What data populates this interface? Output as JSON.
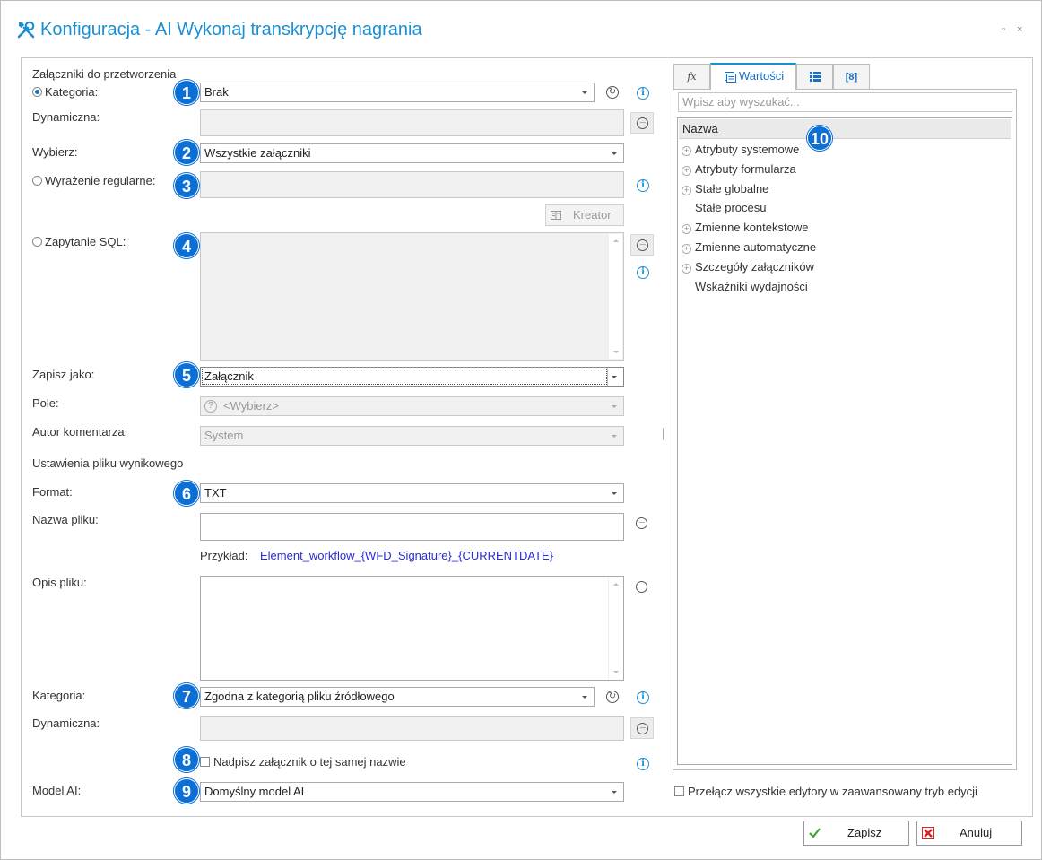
{
  "window": {
    "title": "Konfiguracja - AI Wykonaj transkrypcję nagrania",
    "maximize": "▫",
    "close": "×"
  },
  "badges": [
    "1",
    "2",
    "3",
    "4",
    "5",
    "6",
    "7",
    "8",
    "9",
    "10"
  ],
  "form": {
    "section_attachments": "Załączniki do przetworzenia",
    "kategoria_label": "Kategoria:",
    "kategoria_value": "Brak",
    "dynamiczna_label": "Dynamiczna:",
    "wybierz_label": "Wybierz:",
    "wybierz_value": "Wszystkie załączniki",
    "regex_label": "Wyrażenie regularne:",
    "kreator_label": "Kreator",
    "sql_label": "Zapytanie SQL:",
    "zapisz_jako_label": "Zapisz jako:",
    "zapisz_jako_value": "Załącznik",
    "pole_label": "Pole:",
    "pole_value": "<Wybierz>",
    "autor_label": "Autor komentarza:",
    "autor_value": "System",
    "section_output": "Ustawienia pliku wynikowego",
    "format_label": "Format:",
    "format_value": "TXT",
    "nazwa_label": "Nazwa pliku:",
    "przyklad_label": "Przykład:",
    "przyklad_value": "Element_workflow_{WFD_Signature}_{CURRENTDATE}",
    "opis_label": "Opis pliku:",
    "kategoria2_label": "Kategoria:",
    "kategoria2_value": "Zgodna z kategorią pliku źródłowego",
    "dynamiczna2_label": "Dynamiczna:",
    "nadpisz_label": "Nadpisz załącznik o tej samej nazwie",
    "model_label": "Model AI:",
    "model_value": "Domyślny model AI"
  },
  "right_panel": {
    "tabs": [
      {
        "label": "fx"
      },
      {
        "label": "Wartości"
      },
      {
        "label": ""
      },
      {
        "label": "[8]"
      }
    ],
    "search_placeholder": "Wpisz aby wyszukać...",
    "tree_header": "Nazwa",
    "tree_items": [
      {
        "label": "Atrybuty systemowe",
        "expandable": true
      },
      {
        "label": "Atrybuty formularza",
        "expandable": true
      },
      {
        "label": "Stałe globalne",
        "expandable": true
      },
      {
        "label": "Stałe procesu",
        "expandable": false
      },
      {
        "label": "Zmienne kontekstowe",
        "expandable": true
      },
      {
        "label": "Zmienne automatyczne",
        "expandable": true
      },
      {
        "label": "Szczegóły załączników",
        "expandable": true
      },
      {
        "label": "Wskaźniki wydajności",
        "expandable": false
      }
    ],
    "advanced_toggle": "Przełącz wszystkie edytory w zaawansowany tryb edycji"
  },
  "footer": {
    "save": "Zapisz",
    "cancel": "Anuluj"
  },
  "colors": {
    "accent": "#1a8fd6",
    "badge": "#0c6fd6",
    "link": "#2a2ad6"
  }
}
